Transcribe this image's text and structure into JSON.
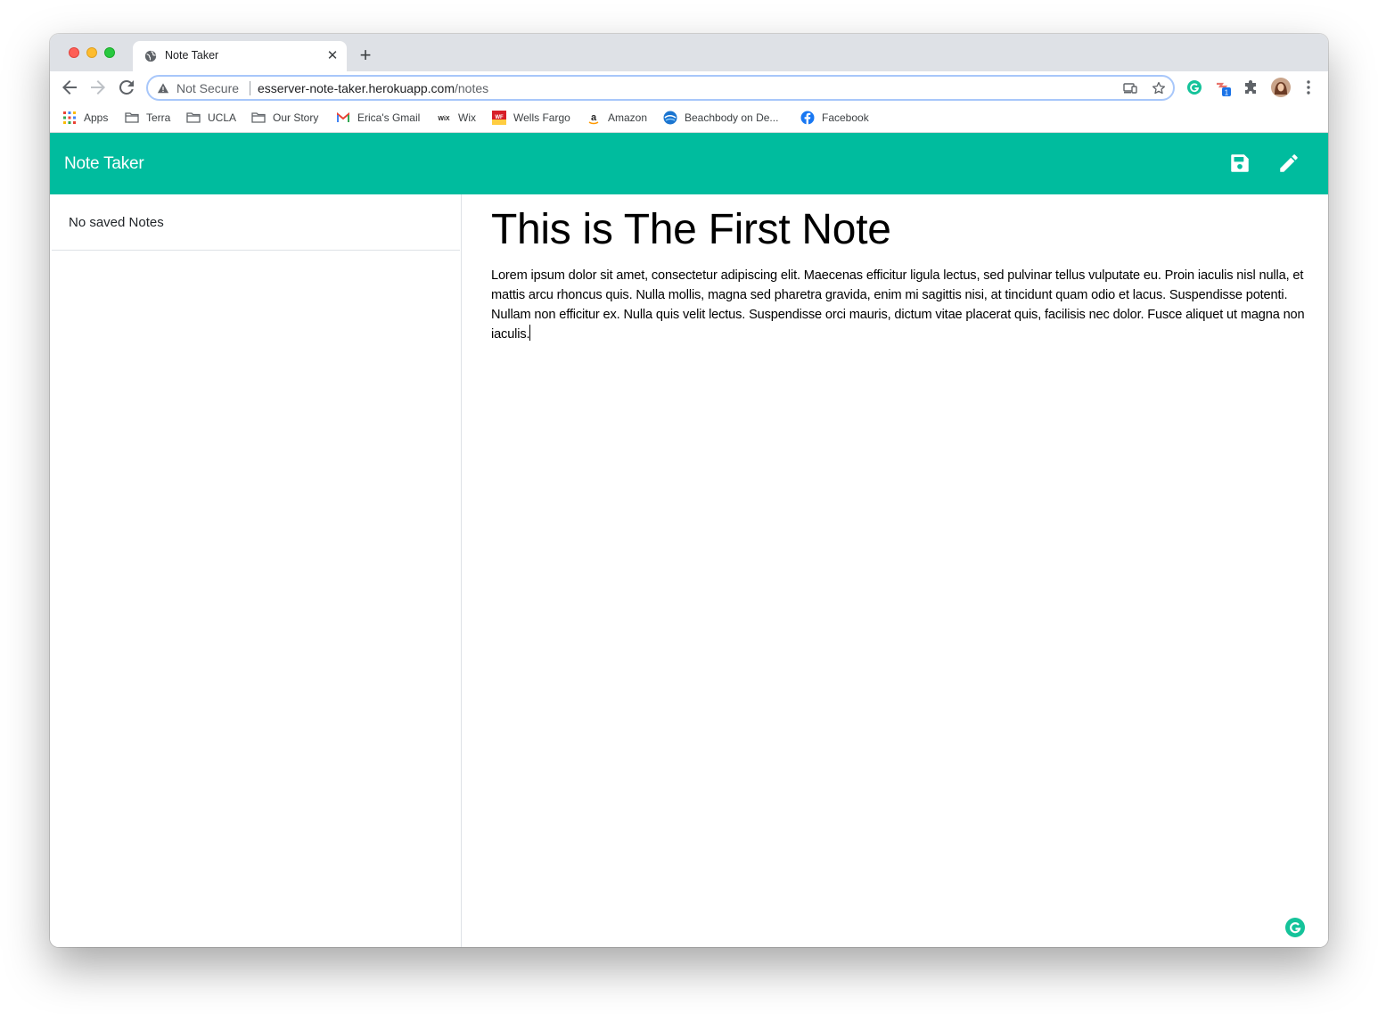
{
  "browser": {
    "tab": {
      "title": "Note Taker",
      "favicon": "globe-icon",
      "close_icon": "close-icon"
    },
    "new_tab_icon": "plus-icon",
    "omnibox": {
      "security_label": "Not Secure",
      "url_host": "esserver-note-taker.herokuapp.com",
      "url_path": "/notes"
    },
    "extension_badge": "1",
    "bookmarks": [
      {
        "label": "Apps",
        "icon": "apps-grid-icon"
      },
      {
        "label": "Terra",
        "icon": "folder-icon"
      },
      {
        "label": "UCLA",
        "icon": "folder-icon"
      },
      {
        "label": "Our Story",
        "icon": "folder-icon"
      },
      {
        "label": "Erica's Gmail",
        "icon": "gmail-icon"
      },
      {
        "label": "Wix",
        "icon": "wix-icon"
      },
      {
        "label": "Wells Fargo",
        "icon": "wells-fargo-icon"
      },
      {
        "label": "Amazon",
        "icon": "amazon-icon"
      },
      {
        "label": "Beachbody on De...",
        "icon": "beachbody-icon"
      },
      {
        "label": "Facebook",
        "icon": "facebook-icon"
      }
    ],
    "wix_logo_text": "WiX",
    "wells_fargo_logo_text": "WF",
    "amazon_logo_text": "a"
  },
  "app": {
    "brand": "Note Taker",
    "accent_color": "#00bc9e",
    "sidebar": {
      "empty_message": "No saved Notes"
    },
    "note": {
      "title": "This is The First Note",
      "text": "Lorem ipsum dolor sit amet, consectetur adipiscing elit. Maecenas efficitur ligula lectus, sed pulvinar tellus vulputate eu. Proin iaculis nisl nulla, et mattis arcu rhoncus quis. Nulla mollis, magna sed pharetra gravida, enim mi sagittis nisi, at tincidunt quam odio et lacus. Suspendisse potenti. Nullam non efficitur ex. Nulla quis velit lectus. Suspendisse orci mauris, dictum vitae placerat quis, facilisis nec dolor. Fusce aliquet ut magna non iaculis."
    }
  }
}
